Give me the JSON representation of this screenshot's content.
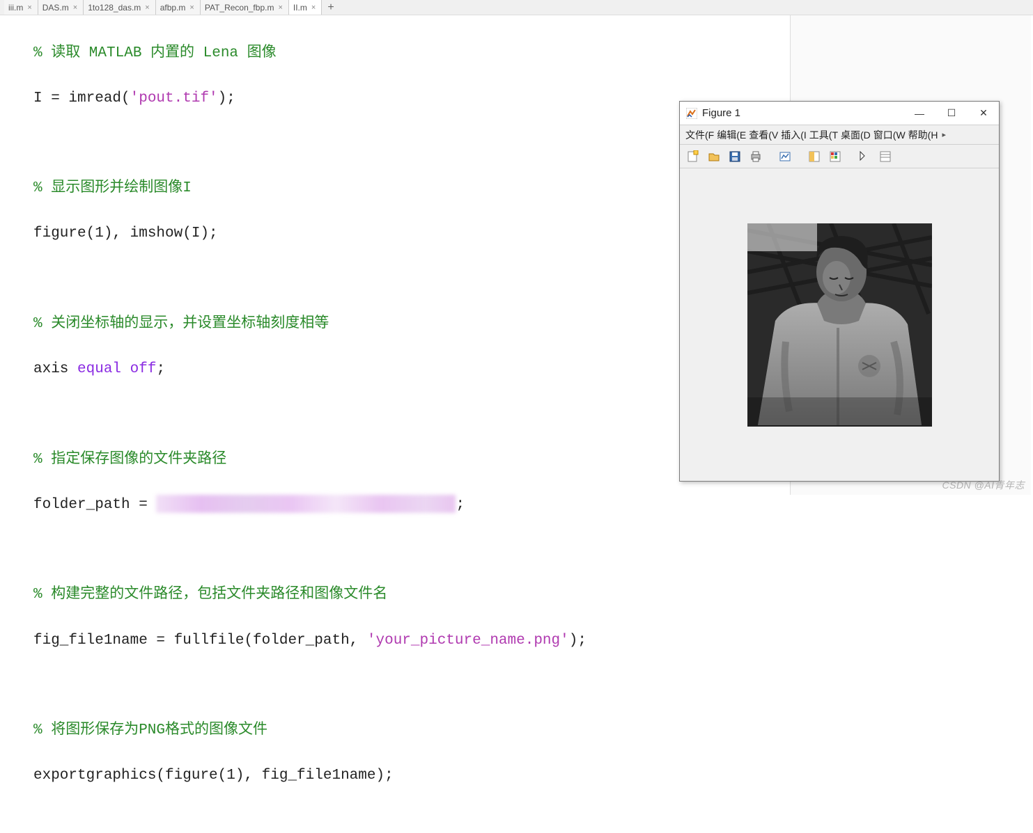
{
  "tabs": [
    {
      "label": "iii.m"
    },
    {
      "label": "DAS.m"
    },
    {
      "label": "1to128_das.m"
    },
    {
      "label": "afbp.m"
    },
    {
      "label": "PAT_Recon_fbp.m"
    },
    {
      "label": "II.m",
      "active": true
    }
  ],
  "tab_add": "+",
  "code": {
    "c1": "% 读取 MATLAB 内置的 Lena 图像",
    "l2a": "I = imread(",
    "l2b": "'pout.tif'",
    "l2c": ");",
    "c3": "% 显示图形并绘制图像I",
    "l4a": "figure(1), imshow(I);",
    "c5": "% 关闭坐标轴的显示，并设置坐标轴刻度相等",
    "l6a": "axis ",
    "l6b": "equal off",
    "l6c": ";",
    "c7": "% 指定保存图像的文件夹路径",
    "l8a": "folder_path = ",
    "l8c": ";",
    "c9": "% 构建完整的文件路径，包括文件夹路径和图像文件名",
    "l10a": "fig_file1name = fullfile(folder_path, ",
    "l10b": "'your_picture_name.png'",
    "l10c": ");",
    "c11": "% 将图形保存为PNG格式的图像文件",
    "l12a": "exportgraphics(figure(1), fig_file1name);"
  },
  "figure": {
    "title": "Figure 1",
    "menus": [
      "文件(F",
      "编辑(E",
      "查看(V",
      "插入(I",
      "工具(T",
      "桌面(D",
      "窗口(W",
      "帮助(H"
    ],
    "menu_arrow": "▸",
    "win": {
      "min": "—",
      "max": "☐",
      "close": "✕"
    }
  },
  "watermark": "CSDN @AI青年志"
}
